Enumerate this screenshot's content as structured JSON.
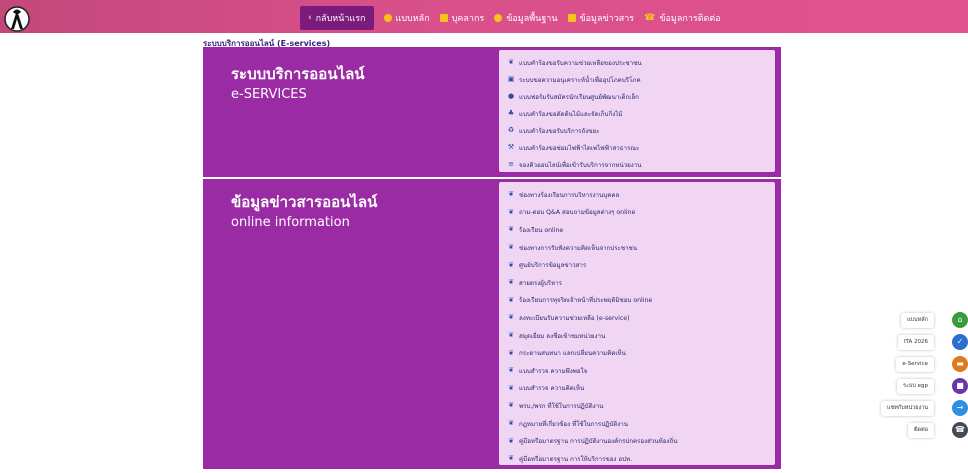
{
  "nav": {
    "back": "กลับหน้าแรก",
    "items": [
      {
        "label": "แบบหลัก"
      },
      {
        "label": "บุคลากร"
      },
      {
        "label": "ข้อมูลพื้นฐาน"
      },
      {
        "label": "ข้อมูลข่าวสาร"
      },
      {
        "label": "ข้อมูลการติดต่อ"
      }
    ]
  },
  "page_label": "ระบบบริการออนไลน์ (E-services)",
  "services": {
    "title_th": "ระบบบริการออนไลน์",
    "title_en": "e-SERVICES",
    "links": [
      {
        "label": "แบบคำร้องขอรับความช่วยเหลือของประชาชน",
        "icon": "users-icon"
      },
      {
        "label": "ระบบขอความอนุเคราะห์น้ำเพื่ออุปโภคบริโภค",
        "icon": "water-icon"
      },
      {
        "label": "แบบฟอร์มรับสมัครนักเรียนศูนย์พัฒนาเด็กเล็ก",
        "icon": "chat-icon"
      },
      {
        "label": "แบบคำร้องขอตัดต้นไม้และจัดเก็บกิ่งไม้",
        "icon": "tree-icon"
      },
      {
        "label": "แบบคำร้องขอรับบริการถังขยะ",
        "icon": "recycle-icon"
      },
      {
        "label": "แบบคำร้องขอซ่อมไฟฟ้าไดเพไฟฟ้าสาธารณะ",
        "icon": "wrench-icon"
      },
      {
        "label": "จองคิวออนไลน์เพื่อเข้ารับบริการจากหน่วยงาน",
        "icon": "list-icon"
      }
    ]
  },
  "info": {
    "title_th": "ข้อมูลข่าวสารออนไลน์",
    "title_en": "online information",
    "links": [
      {
        "label": "ช่องทางร้องเรียนการบริหารงานบุคคล"
      },
      {
        "label": "ถาม-ตอบ Q&A สอบถามข้อมูลต่างๆ online"
      },
      {
        "label": "ร้องเรียน online"
      },
      {
        "label": "ช่องทางการรับฟังความคิดเห็นจากประชาชน"
      },
      {
        "label": "ศูนย์บริการข้อมูลข่าวสาร"
      },
      {
        "label": "สายตรงผู้บริหาร"
      },
      {
        "label": "ร้องเรียนการทุจริตเจ้าหน้าที่ประพฤติมิชอบ online"
      },
      {
        "label": "ลงทะเบียนรับความช่วยเหลือ (e-service)"
      },
      {
        "label": "สมุดเยี่ยม ลงชื่อเข้าชมหน่วยงาน"
      },
      {
        "label": "กระดานสนทนา แลกเปลี่ยนความคิดเห็น"
      },
      {
        "label": "แบบสำรวจ ความพึงพอใจ"
      },
      {
        "label": "แบบสำรวจ ความคิดเห็น"
      },
      {
        "label": "พรบ./พรก ที่ใช้ในการปฏิบัติงาน"
      },
      {
        "label": "กฎหมายที่เกี่ยวข้อง ที่ใช้ในการปฏิบัติงาน"
      },
      {
        "label": "คู่มือหรือมาตรฐาน การปฏิบัติงานองค์กรปกครองส่วนท้องถิ่น"
      },
      {
        "label": "คู่มือหรือมาตรฐาน การให้บริการของ อปท."
      }
    ]
  },
  "floating": [
    {
      "label": "แบบหลัก",
      "color": "#3a9b3f",
      "icon": "home-icon"
    },
    {
      "label": "ITA 2026",
      "color": "#2c6fd1",
      "icon": "check-icon"
    },
    {
      "label": "e-Service",
      "color": "#e07a1f",
      "icon": "chat-icon"
    },
    {
      "label": "ระบบ egp",
      "color": "#6c35a8",
      "icon": "doc-icon"
    },
    {
      "label": "แชทกับหน่วยงาน",
      "color": "#2f8fe0",
      "icon": "message-icon"
    },
    {
      "label": "ติดต่อ",
      "color": "#444c55",
      "icon": "phone-icon"
    }
  ]
}
